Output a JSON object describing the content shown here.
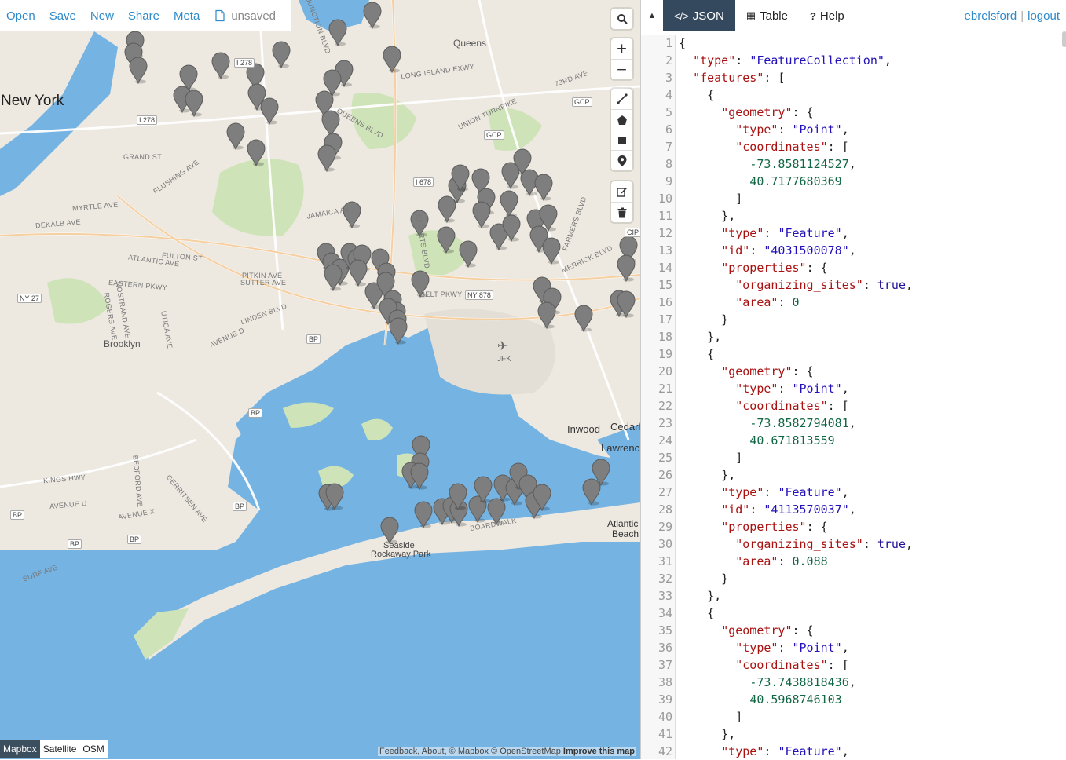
{
  "menu": {
    "open": "Open",
    "save": "Save",
    "new": "New",
    "share": "Share",
    "meta": "Meta",
    "file_status": "unsaved"
  },
  "map": {
    "place_labels": {
      "new_york": "New York",
      "brooklyn": "Brooklyn",
      "queens": "Queens",
      "inwood": "Inwood",
      "cedarhurst": "Cedarh",
      "lawrence": "Lawrenc",
      "atlantic_beach_1": "Atlantic",
      "atlantic_beach_2": "Beach",
      "seaside": "Seaside",
      "rockaway_park": "Rockaway Park",
      "jfk": "JFK"
    },
    "road_labels": [
      "LONG ISLAND EXWY",
      "JUNCTION BLVD",
      "QUEENS BLVD",
      "UNION TURNPIKE",
      "73RD AVE",
      "GRAND ST",
      "FLUSHING AVE",
      "MYRTLE AVE",
      "DEKALB AVE",
      "JAMAICA AV",
      "FULTON ST",
      "ATLANTIC AVE",
      "PITKIN AVE",
      "SUTTER AVE",
      "EASTERN PKWY",
      "LINDEN BLVD",
      "BELT PKWY",
      "FARMERS BLVD",
      "MERRICK BLVD",
      "LEFFERTS BLVD",
      "AVENUE D",
      "AVENUE U",
      "KINGS HWY",
      "BEDFORD AVE",
      "SURF AVE",
      "BOARDWALK",
      "GERRITSEN AVE",
      "AVENUE X",
      "UTICA AVE",
      "NOSTRAND AVE",
      "ROGERS AVE"
    ],
    "shields": [
      "I 278",
      "I 278",
      "I 678",
      "NY 878",
      "NY 27",
      "BP",
      "BP",
      "BP",
      "BP",
      "BP",
      "BP",
      "GCP",
      "GCP",
      "CIP"
    ],
    "layers": {
      "mapbox": "Mapbox",
      "satellite": "Satellite",
      "osm": "OSM",
      "active": "Mapbox"
    },
    "attribution": {
      "feedback": "Feedback",
      "about": "About",
      "mapbox": "© Mapbox",
      "osm": "© OpenStreetMap",
      "improve": "Improve this map"
    },
    "controls": {
      "search": "search-icon",
      "zoom_in": "+",
      "zoom_out": "−"
    }
  },
  "pane": {
    "tabs": [
      {
        "label": "JSON",
        "icon": "code-icon"
      },
      {
        "label": "Table",
        "icon": "table-icon"
      },
      {
        "label": "Help",
        "icon": "question-icon"
      }
    ],
    "user": {
      "name": "ebrelsford",
      "logout": "logout"
    }
  },
  "code_lines": [
    "{",
    "  \"type\": \"FeatureCollection\",",
    "  \"features\": [",
    "    {",
    "      \"geometry\": {",
    "        \"type\": \"Point\",",
    "        \"coordinates\": [",
    "          -73.8581124527,",
    "          40.7177680369",
    "        ]",
    "      },",
    "      \"type\": \"Feature\",",
    "      \"id\": \"4031500078\",",
    "      \"properties\": {",
    "        \"organizing_sites\": true,",
    "        \"area\": 0",
    "      }",
    "    },",
    "    {",
    "      \"geometry\": {",
    "        \"type\": \"Point\",",
    "        \"coordinates\": [",
    "          -73.8582794081,",
    "          40.671813559",
    "        ]",
    "      },",
    "      \"type\": \"Feature\",",
    "      \"id\": \"4113570037\",",
    "      \"properties\": {",
    "        \"organizing_sites\": true,",
    "        \"area\": 0.088",
    "      }",
    "    },",
    "    {",
    "      \"geometry\": {",
    "        \"type\": \"Point\",",
    "        \"coordinates\": [",
    "          -73.7438818436,",
    "          40.5968746103",
    "        ]",
    "      },",
    "      \"type\": \"Feature\","
  ]
}
